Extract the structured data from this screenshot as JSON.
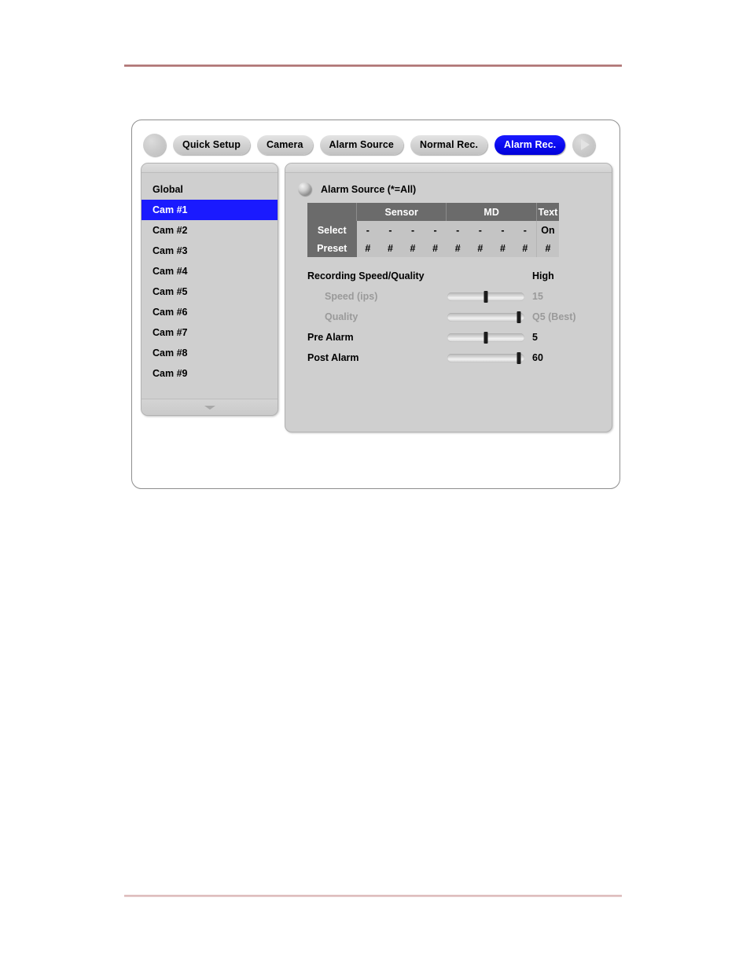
{
  "page": {
    "rule_color_top": "#a96c6c",
    "rule_color_bottom": "#e0c2c2"
  },
  "dialog": {
    "nav": {
      "prev_label": "",
      "next_label": ""
    },
    "tabs": [
      {
        "label": "Quick Setup",
        "active": false
      },
      {
        "label": "Camera",
        "active": false
      },
      {
        "label": "Alarm Source",
        "active": false
      },
      {
        "label": "Normal Rec.",
        "active": false
      },
      {
        "label": "Alarm Rec.",
        "active": true
      }
    ],
    "active_tab_color": "#1a1aff",
    "sidebar": {
      "items": [
        {
          "label": "Global",
          "selected": false
        },
        {
          "label": "Cam #1",
          "selected": true
        },
        {
          "label": "Cam #2",
          "selected": false
        },
        {
          "label": "Cam #3",
          "selected": false
        },
        {
          "label": "Cam #4",
          "selected": false
        },
        {
          "label": "Cam #5",
          "selected": false
        },
        {
          "label": "Cam #6",
          "selected": false
        },
        {
          "label": "Cam #7",
          "selected": false
        },
        {
          "label": "Cam #8",
          "selected": false
        },
        {
          "label": "Cam #9",
          "selected": false
        }
      ],
      "scroll_down_icon": "chevron-down-icon"
    },
    "panel": {
      "section_title": "Alarm Source (*=All)",
      "section_icon": "sphere-bullet-icon",
      "table": {
        "corner_label": "",
        "group_headers": [
          {
            "label": "Sensor",
            "span": 4
          },
          {
            "label": "MD",
            "span": 4
          },
          {
            "label": "Text",
            "span": 1
          }
        ],
        "rows": [
          {
            "label": "Select",
            "cells": [
              "-",
              "-",
              "-",
              "-",
              "-",
              "-",
              "-",
              "-",
              "On"
            ]
          },
          {
            "label": "Preset",
            "cells": [
              "#",
              "#",
              "#",
              "#",
              "#",
              "#",
              "#",
              "#",
              "#"
            ]
          }
        ]
      },
      "settings": [
        {
          "label": "Recording Speed/Quality",
          "value": "High",
          "has_slider": false,
          "dimmed": false,
          "indent": false
        },
        {
          "label": "Speed (ips)",
          "value": "15",
          "has_slider": true,
          "slider_percent": 50,
          "dimmed": true,
          "indent": true
        },
        {
          "label": "Quality",
          "value": "Q5 (Best)",
          "has_slider": true,
          "slider_percent": 93,
          "dimmed": true,
          "indent": true
        },
        {
          "label": "Pre Alarm",
          "value": "5",
          "has_slider": true,
          "slider_percent": 50,
          "dimmed": false,
          "indent": false
        },
        {
          "label": "Post Alarm",
          "value": "60",
          "has_slider": true,
          "slider_percent": 93,
          "dimmed": false,
          "indent": false
        }
      ]
    }
  }
}
